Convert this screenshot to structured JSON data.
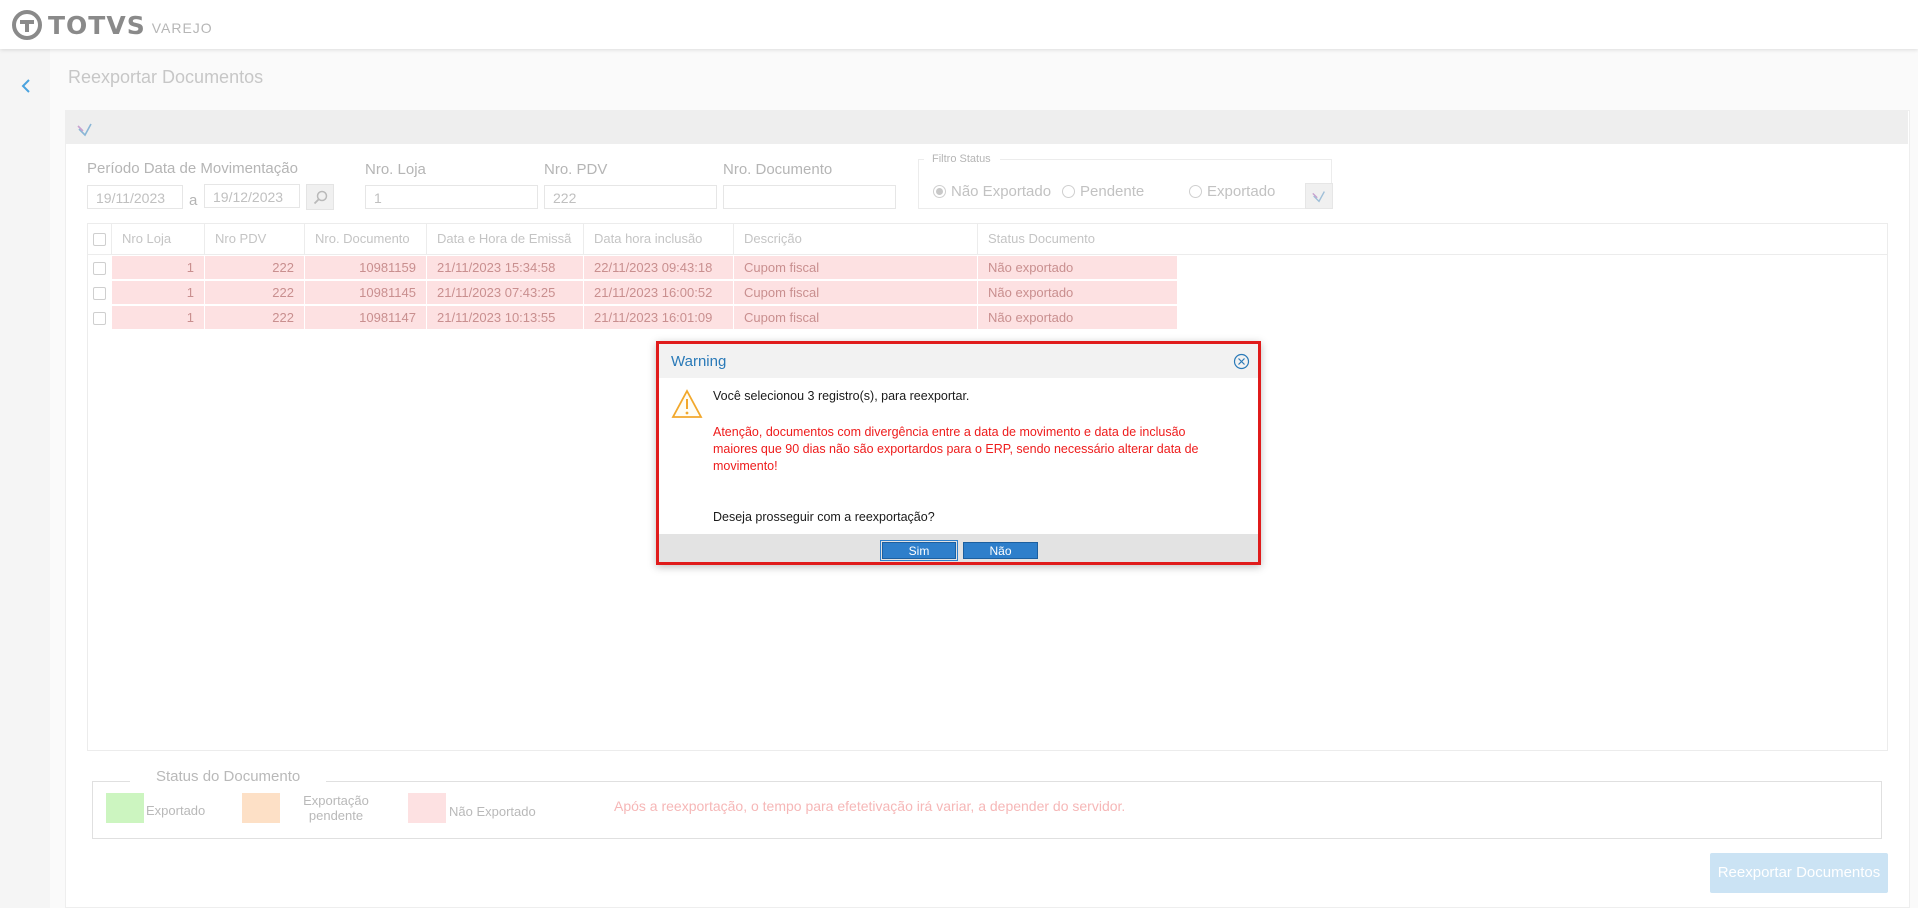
{
  "header": {
    "brand": "TOTVS",
    "brand_sub": "VAREJO"
  },
  "page": {
    "title": "Reexportar Documentos"
  },
  "filters": {
    "periodo_label": "Período Data de Movimentação",
    "date_from": "19/11/2023",
    "date_sep": "a",
    "date_to": "19/12/2023",
    "loja_label": "Nro. Loja",
    "loja_value": "1",
    "pdv_label": "Nro. PDV",
    "pdv_value": "222",
    "doc_label": "Nro. Documento",
    "doc_value": "",
    "status_legend": "Filtro Status",
    "status_options": [
      "Não Exportado",
      "Pendente",
      "Exportado"
    ],
    "status_selected": "Não Exportado"
  },
  "grid": {
    "columns": [
      "Nro Loja",
      "Nro PDV",
      "Nro. Documento",
      "Data e Hora de Emissã",
      "Data hora inclusão",
      "Descrição",
      "Status Documento"
    ],
    "rows": [
      [
        "1",
        "222",
        "10981159",
        "21/11/2023 15:34:58",
        "22/11/2023 09:43:18",
        "Cupom fiscal",
        "Não exportado"
      ],
      [
        "1",
        "222",
        "10981145",
        "21/11/2023 07:43:25",
        "21/11/2023 16:00:52",
        "Cupom fiscal",
        "Não exportado"
      ],
      [
        "1",
        "222",
        "10981147",
        "21/11/2023 10:13:55",
        "21/11/2023 16:01:09",
        "Cupom fiscal",
        "Não exportado"
      ]
    ]
  },
  "legend": {
    "title": "Status do Documento",
    "exportado": "Exportado",
    "pendente": "Exportação pendente",
    "nao_exportado": "Não Exportado",
    "note": "Após a reexportação, o tempo para efetetivação irá variar, a depender do servidor."
  },
  "actions": {
    "reexport": "Reexportar Documentos"
  },
  "dialog": {
    "title": "Warning",
    "message": "Você selecionou 3 registro(s), para reexportar.",
    "warning": "Atenção, documentos com divergência entre a data de movimento e data de inclusão maiores que 90 dias não são exportardos para o ERP, sendo necessário alterar data de movimento!",
    "question": "Deseja prosseguir com a reexportação?",
    "yes": "Sim",
    "no": "Não"
  },
  "colors": {
    "exportado": "#ccf5c0",
    "pendente": "#fde0c6",
    "nao_exportado": "#fde1e2",
    "accent": "#2e7fcb",
    "dialog_border": "#e01b1b"
  }
}
